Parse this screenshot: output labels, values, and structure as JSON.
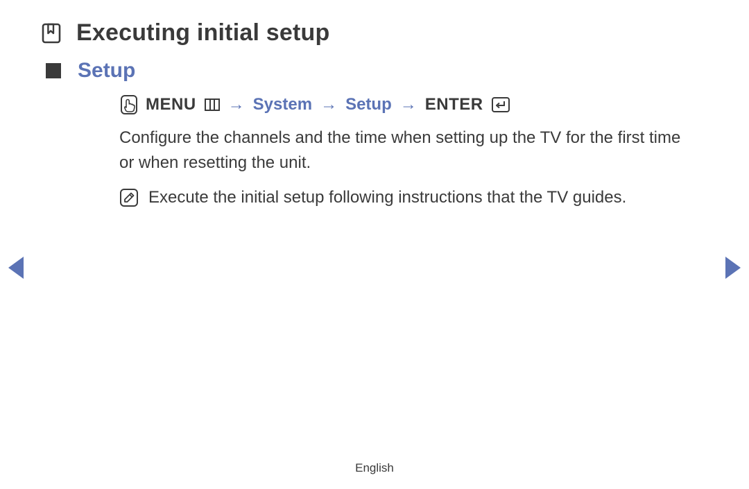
{
  "title": "Executing initial setup",
  "section": {
    "heading": "Setup"
  },
  "path": {
    "menu_label": "MENU",
    "sep": "→",
    "items": [
      "System",
      "Setup"
    ],
    "enter_label": "ENTER"
  },
  "body": "Configure the channels and the time when setting up the TV for the first time or when resetting the unit.",
  "note": "Execute the initial setup following instructions that the TV guides.",
  "footer": {
    "language": "English"
  }
}
